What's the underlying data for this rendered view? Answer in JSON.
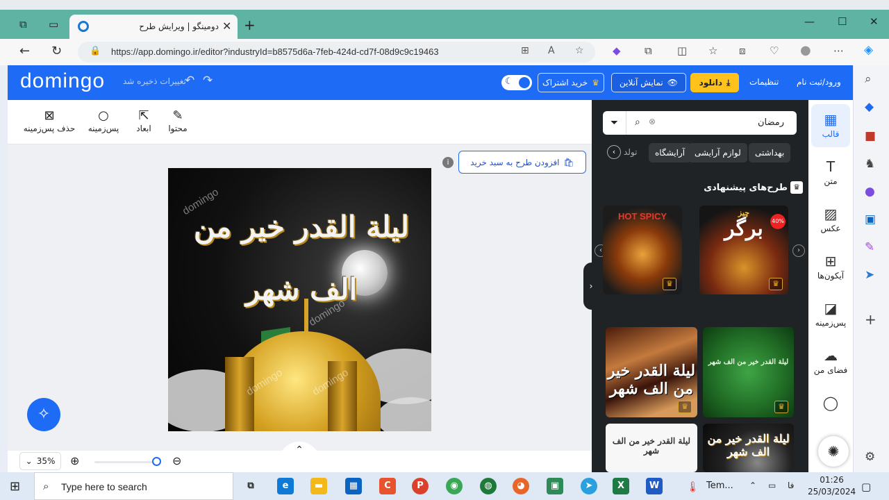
{
  "browser": {
    "tab_title": "دومینگو | ویرایش طرح",
    "url": "https://app.domingo.ir/editor?industryId=b8575d6a-7feb-424d-cd7f-08d9c9c19463"
  },
  "header": {
    "logo": "domingo",
    "saved_status": "تغییرات ذخیره شد",
    "subscribe": "خرید اشتراک",
    "online_preview": "نمایش آنلاین",
    "download": "دانلود",
    "settings": "تنظیمات",
    "login": "ورود/ثبت نام"
  },
  "toolbar": {
    "content": "محتوا",
    "dimensions": "ابعاد",
    "background": "پس‌زمینه",
    "remove_background": "حذف پس‌زمینه"
  },
  "editor": {
    "add_to_cart": "افزودن طرح به سبد خرید",
    "zoom": "35%",
    "canvas_calligraphy": "ليلة القدر خير من الف شهر",
    "watermark": "domingo"
  },
  "panel": {
    "search_value": "رمضان",
    "chips": [
      "بهداشتی",
      "لوازم آرایشی",
      "آرایشگاه"
    ],
    "chip_cut": "تولد",
    "suggested_title": "طرح‌های پیشنهادی",
    "card_burger": "برگر",
    "card_burger_top": "چیز",
    "card_hot": "HOT SPICY",
    "card_discount": "40%"
  },
  "rail": {
    "items": [
      "قالب",
      "متن",
      "عکس",
      "آیکون‌ها",
      "پس‌زمینه",
      "فضای من"
    ]
  },
  "taskbar": {
    "search_placeholder": "Type here to search",
    "temp": "Tem...",
    "lang": "فا",
    "time": "01:26",
    "date": "25/03/2024"
  },
  "colors": {
    "brand_blue": "#1e6cf5",
    "download_yellow": "#ffc21a",
    "panel_dark": "#202325"
  }
}
